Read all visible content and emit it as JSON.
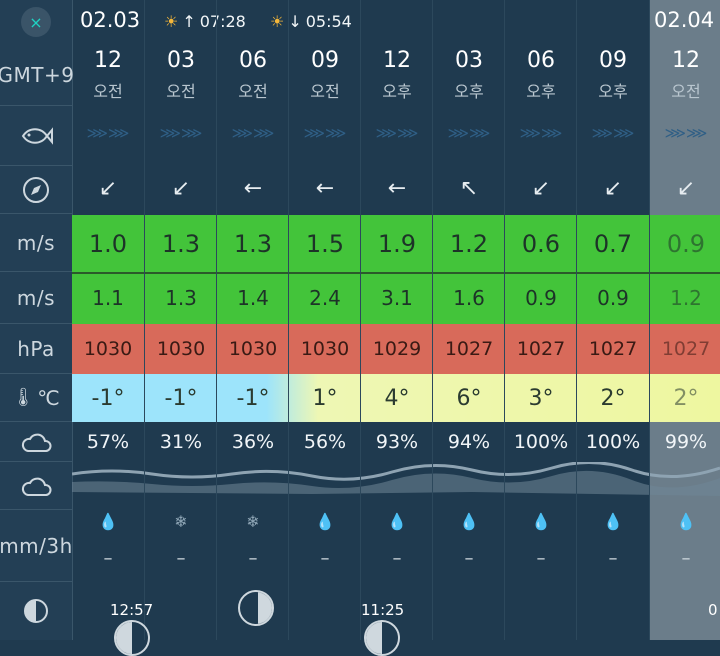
{
  "sidebar": {
    "close_icon": "×",
    "timezone": "GMT+9",
    "wind_unit": "m/s",
    "gust_unit": "m/s",
    "pressure_unit": "hPa",
    "temp_unit": "℃",
    "rain_unit": "mm/3h"
  },
  "header": {
    "date1": "02.03",
    "sunrise": "07:28",
    "sunset": "05:54",
    "date2": "02.04"
  },
  "columns": [
    {
      "hour": "12",
      "ampm": "오전",
      "dir": "↙",
      "wind": "1.0",
      "gust": "1.1",
      "pressure": "1030",
      "temp": "-1°",
      "cloud": "57%",
      "precip": "drop",
      "rain": "–"
    },
    {
      "hour": "03",
      "ampm": "오전",
      "dir": "↙",
      "wind": "1.3",
      "gust": "1.3",
      "pressure": "1030",
      "temp": "-1°",
      "cloud": "31%",
      "precip": "snow",
      "rain": "–"
    },
    {
      "hour": "06",
      "ampm": "오전",
      "dir": "←",
      "wind": "1.3",
      "gust": "1.4",
      "pressure": "1030",
      "temp": "-1°",
      "cloud": "36%",
      "precip": "snow",
      "rain": "–"
    },
    {
      "hour": "09",
      "ampm": "오전",
      "dir": "←",
      "wind": "1.5",
      "gust": "2.4",
      "pressure": "1030",
      "temp": "1°",
      "cloud": "56%",
      "precip": "drop",
      "rain": "–"
    },
    {
      "hour": "12",
      "ampm": "오후",
      "dir": "←",
      "wind": "1.9",
      "gust": "3.1",
      "pressure": "1029",
      "temp": "4°",
      "cloud": "93%",
      "precip": "drop",
      "rain": "–"
    },
    {
      "hour": "03",
      "ampm": "오후",
      "dir": "↖",
      "wind": "1.2",
      "gust": "1.6",
      "pressure": "1027",
      "temp": "6°",
      "cloud": "94%",
      "precip": "drop",
      "rain": "–"
    },
    {
      "hour": "06",
      "ampm": "오후",
      "dir": "↙",
      "wind": "0.6",
      "gust": "0.9",
      "pressure": "1027",
      "temp": "3°",
      "cloud": "100%",
      "precip": "drop",
      "rain": "–"
    },
    {
      "hour": "09",
      "ampm": "오후",
      "dir": "↙",
      "wind": "0.7",
      "gust": "0.9",
      "pressure": "1027",
      "temp": "2°",
      "cloud": "100%",
      "precip": "drop",
      "rain": "–"
    },
    {
      "hour": "12",
      "ampm": "오전",
      "dir": "↙",
      "wind": "0.9",
      "gust": "1.2",
      "pressure": "1027",
      "temp": "2°",
      "cloud": "99%",
      "precip": "drop",
      "rain": "–"
    }
  ],
  "moon": {
    "rise_time": "12:57",
    "set_time": "11:25",
    "next_time": "0"
  }
}
